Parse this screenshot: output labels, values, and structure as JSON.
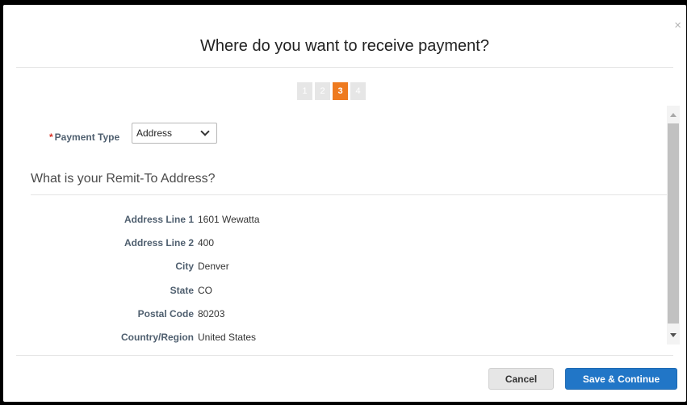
{
  "dialog": {
    "title": "Where do you want to receive payment?",
    "close_glyph": "×"
  },
  "stepper": {
    "steps": [
      "1",
      "2",
      "3",
      "4"
    ],
    "active_step": "3"
  },
  "payment_type": {
    "required_marker": "*",
    "label": "Payment Type",
    "selected": "Address"
  },
  "remit_section": {
    "title": "What is your Remit-To Address?",
    "fields": [
      {
        "label": "Address Line 1",
        "value": "1601 Wewatta"
      },
      {
        "label": "Address Line 2",
        "value": "400"
      },
      {
        "label": "City",
        "value": "Denver"
      },
      {
        "label": "State",
        "value": "CO"
      },
      {
        "label": "Postal Code",
        "value": "80203"
      },
      {
        "label": "Country/Region",
        "value": "United States"
      }
    ]
  },
  "buttons": {
    "cancel": "Cancel",
    "save": "Save & Continue"
  },
  "colors": {
    "accent": "#ee7a1f",
    "primary_button": "#2176c7",
    "required": "#d93025"
  }
}
